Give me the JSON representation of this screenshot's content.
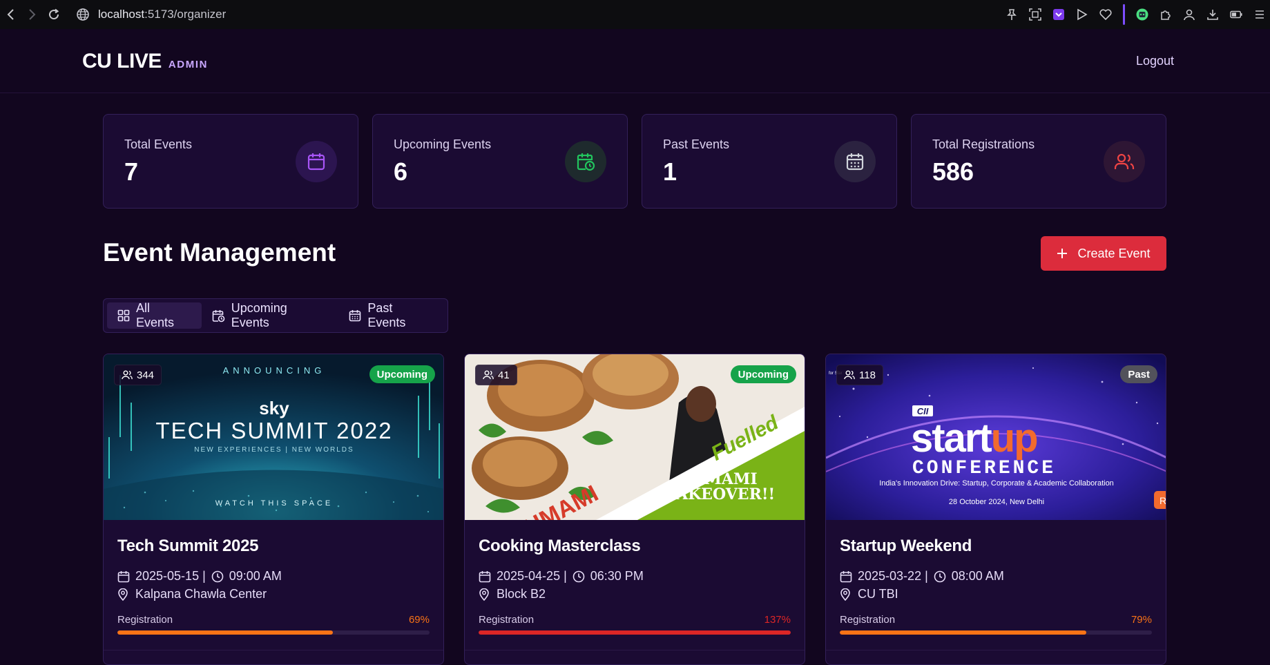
{
  "browser": {
    "url_host": "localhost",
    "url_path": ":5173/organizer"
  },
  "header": {
    "brand": "CU LIVE",
    "tag": "ADMIN",
    "logout": "Logout"
  },
  "stats": [
    {
      "label": "Total Events",
      "value": "7",
      "icon": "calendar-icon",
      "color": "#a855f7"
    },
    {
      "label": "Upcoming Events",
      "value": "6",
      "icon": "calendar-clock-icon",
      "color": "#22c55e"
    },
    {
      "label": "Past Events",
      "value": "1",
      "icon": "calendar-grid-icon",
      "color": "#d1d5db"
    },
    {
      "label": "Total Registrations",
      "value": "586",
      "icon": "users-icon",
      "color": "#ef4444"
    }
  ],
  "section": {
    "title": "Event Management",
    "create_label": "Create Event"
  },
  "tabs": [
    {
      "label": "All Events",
      "active": true
    },
    {
      "label": "Upcoming Events",
      "active": false
    },
    {
      "label": "Past Events",
      "active": false
    }
  ],
  "events": [
    {
      "title": "Tech Summit 2025",
      "count": "344",
      "status": "Upcoming",
      "status_color": "#16a34a",
      "date": "2025-05-15 |",
      "time": "09:00 AM",
      "venue": "Kalpana Chawla Center",
      "reg_label": "Registration",
      "reg_pct": "69%",
      "reg_value": 69,
      "reg_color": "#f97316",
      "image": {
        "top": "ANNOUNCING",
        "brand": "sky",
        "headline": "TECH SUMMIT 2022",
        "sub": "NEW EXPERIENCES | NEW WORLDS",
        "foot": "WATCH THIS SPACE"
      }
    },
    {
      "title": "Cooking Masterclass",
      "count": "41",
      "status": "Upcoming",
      "status_color": "#16a34a",
      "date": "2025-04-25 |",
      "time": "06:30 PM",
      "venue": "Block B2",
      "reg_label": "Registration",
      "reg_pct": "137%",
      "reg_value": 137,
      "reg_color": "#dc2626",
      "image": {
        "banner": "Fuelled",
        "brand": "UMAMI",
        "line1": "UMAMI",
        "line2": "TAKEOVER!!"
      }
    },
    {
      "title": "Startup Weekend",
      "count": "118",
      "status": "Past",
      "status_color": "#52525b",
      "date": "2025-03-22 |",
      "time": "08:00 AM",
      "venue": "CU TBI",
      "reg_label": "Registration",
      "reg_pct": "79%",
      "reg_value": 79,
      "reg_color": "#f97316",
      "image": {
        "corner": "for Star",
        "logo": "CII",
        "word_a": "start",
        "word_b": "up",
        "word_c": "CONFERENCE",
        "tagline": "India's Innovation Drive: Startup, Corporate & Academic Collaboration",
        "dateline": "28 October 2024, New Delhi",
        "side": "R"
      }
    }
  ]
}
